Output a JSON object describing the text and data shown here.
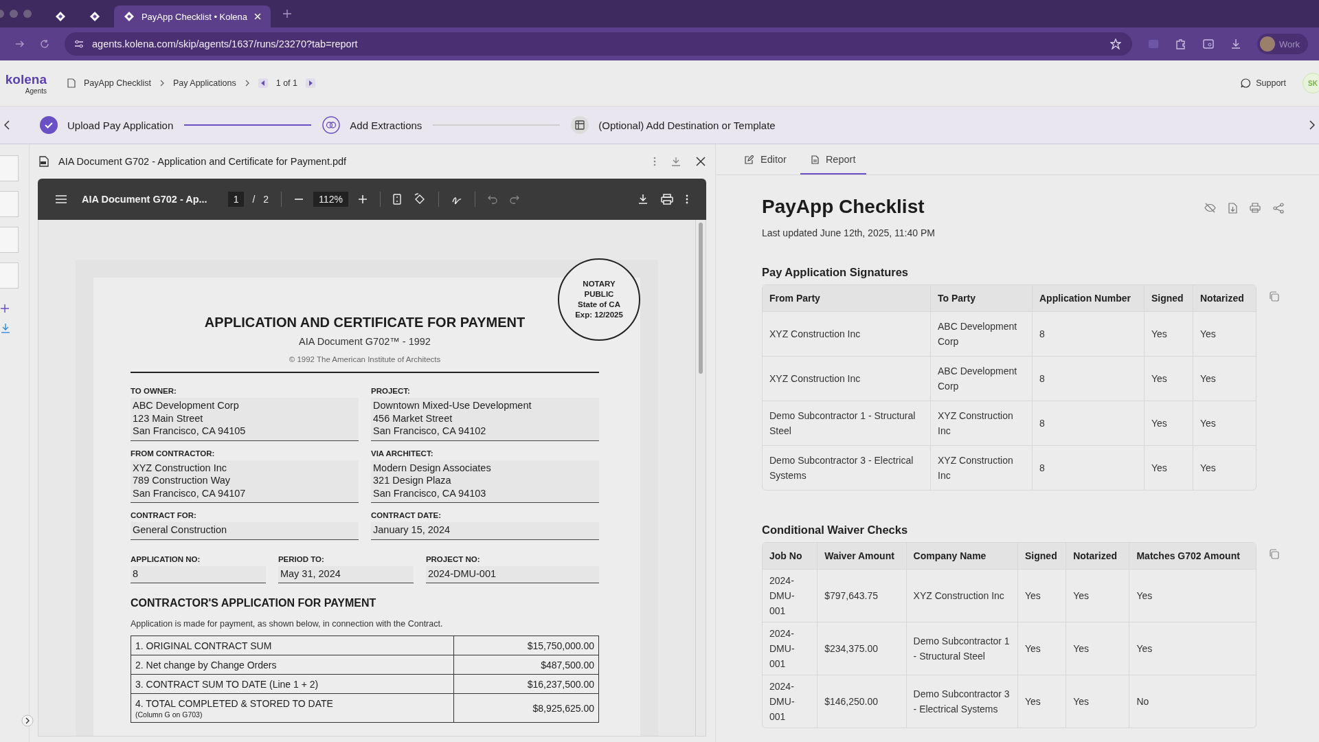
{
  "browser": {
    "tabs": [
      {
        "kind": "icon",
        "selected": false
      },
      {
        "kind": "icon",
        "selected": false
      },
      {
        "kind": "titled",
        "title": "PayApp Checklist • Kolena",
        "selected": true
      }
    ],
    "url": "agents.kolena.com/skip/agents/1637/runs/23270?tab=report",
    "profile": "Work"
  },
  "header": {
    "logo": "kolena",
    "logo_sub": "Agents",
    "breadcrumbs": [
      "PayApp Checklist",
      "Pay Applications"
    ],
    "pager": "1 of 1",
    "support": "Support",
    "avatar": "SK"
  },
  "steps": [
    {
      "label": "Upload Pay Application",
      "kind": "done"
    },
    {
      "label": "Add Extractions",
      "kind": "current"
    },
    {
      "label": "(Optional) Add Destination or Template",
      "kind": "pending"
    }
  ],
  "pdf": {
    "filename": "AIA Document G702 - Application and Certificate for Payment.pdf",
    "toolbar_title": "AIA Document G702 - Ap...",
    "page": "1",
    "separator": "/",
    "pages": "2",
    "zoom": "112%"
  },
  "document": {
    "title": "APPLICATION AND CERTIFICATE FOR PAYMENT",
    "subtitle": "AIA Document G702™ - 1992",
    "copyright": "© 1992 The American Institute of Architects",
    "stamp": [
      "NOTARY",
      "PUBLIC",
      "State of CA",
      "Exp: 12/2025"
    ],
    "fields": [
      {
        "label": "TO OWNER:",
        "lines": [
          "ABC Development Corp",
          "123 Main Street",
          "San Francisco, CA 94105"
        ]
      },
      {
        "label": "PROJECT:",
        "lines": [
          "Downtown Mixed-Use Development",
          "456 Market Street",
          "San Francisco, CA 94102"
        ]
      },
      {
        "label": "FROM CONTRACTOR:",
        "lines": [
          "XYZ Construction Inc",
          "789 Construction Way",
          "San Francisco, CA 94107"
        ]
      },
      {
        "label": "VIA ARCHITECT:",
        "lines": [
          "Modern Design Associates",
          "321 Design Plaza",
          "San Francisco, CA 94103"
        ]
      },
      {
        "label": "CONTRACT FOR:",
        "lines": [
          "General Construction"
        ]
      },
      {
        "label": "CONTRACT DATE:",
        "lines": [
          "January 15, 2024"
        ]
      }
    ],
    "numbers": [
      {
        "label": "APPLICATION NO:",
        "value": "8"
      },
      {
        "label": "PERIOD TO:",
        "value": "May 31, 2024"
      },
      {
        "label": "PROJECT NO:",
        "value": "2024-DMU-001"
      }
    ],
    "section": "CONTRACTOR'S APPLICATION FOR PAYMENT",
    "intro": "Application is made for payment, as shown below, in connection with the Contract.",
    "lines": [
      {
        "label": "1. ORIGINAL CONTRACT SUM",
        "amount": "$15,750,000.00"
      },
      {
        "label": "2. Net change by Change Orders",
        "amount": "$487,500.00"
      },
      {
        "label": "3. CONTRACT SUM TO DATE (Line 1 + 2)",
        "amount": "$16,237,500.00"
      },
      {
        "label": "4. TOTAL COMPLETED & STORED TO DATE",
        "note": "(Column G on G703)",
        "amount": "$8,925,625.00"
      }
    ]
  },
  "report": {
    "tabs": [
      {
        "label": "Editor",
        "kind": "edit",
        "selected": false
      },
      {
        "label": "Report",
        "kind": "doc",
        "selected": true
      }
    ],
    "title": "PayApp Checklist",
    "updated": "Last updated June 12th, 2025, 11:40 PM",
    "tables": [
      {
        "title": "Pay Application Signatures",
        "columns": [
          "From Party",
          "To Party",
          "Application Number",
          "Signed",
          "Notarized"
        ],
        "rows": [
          [
            "XYZ Construction Inc",
            "ABC Development Corp",
            "8",
            "Yes",
            "Yes"
          ],
          [
            "XYZ Construction Inc",
            "ABC Development Corp",
            "8",
            "Yes",
            "Yes"
          ],
          [
            "Demo Subcontractor 1 - Structural Steel",
            "XYZ Construction Inc",
            "8",
            "Yes",
            "Yes"
          ],
          [
            "Demo Subcontractor 3 - Electrical Systems",
            "XYZ Construction Inc",
            "8",
            "Yes",
            "Yes"
          ]
        ]
      },
      {
        "title": "Conditional Waiver Checks",
        "columns": [
          "Job No",
          "Waiver Amount",
          "Company Name",
          "Signed",
          "Notarized",
          "Matches G702 Amount"
        ],
        "rows": [
          [
            "2024-DMU-001",
            "$797,643.75",
            "XYZ Construction Inc",
            "Yes",
            "Yes",
            "Yes"
          ],
          [
            "2024-DMU-001",
            "$234,375.00",
            "Demo Subcontractor 1 - Structural Steel",
            "Yes",
            "Yes",
            "Yes"
          ],
          [
            "2024-DMU-001",
            "$146,250.00",
            "Demo Subcontractor 3 - Electrical Systems",
            "Yes",
            "Yes",
            "No"
          ]
        ]
      }
    ]
  }
}
